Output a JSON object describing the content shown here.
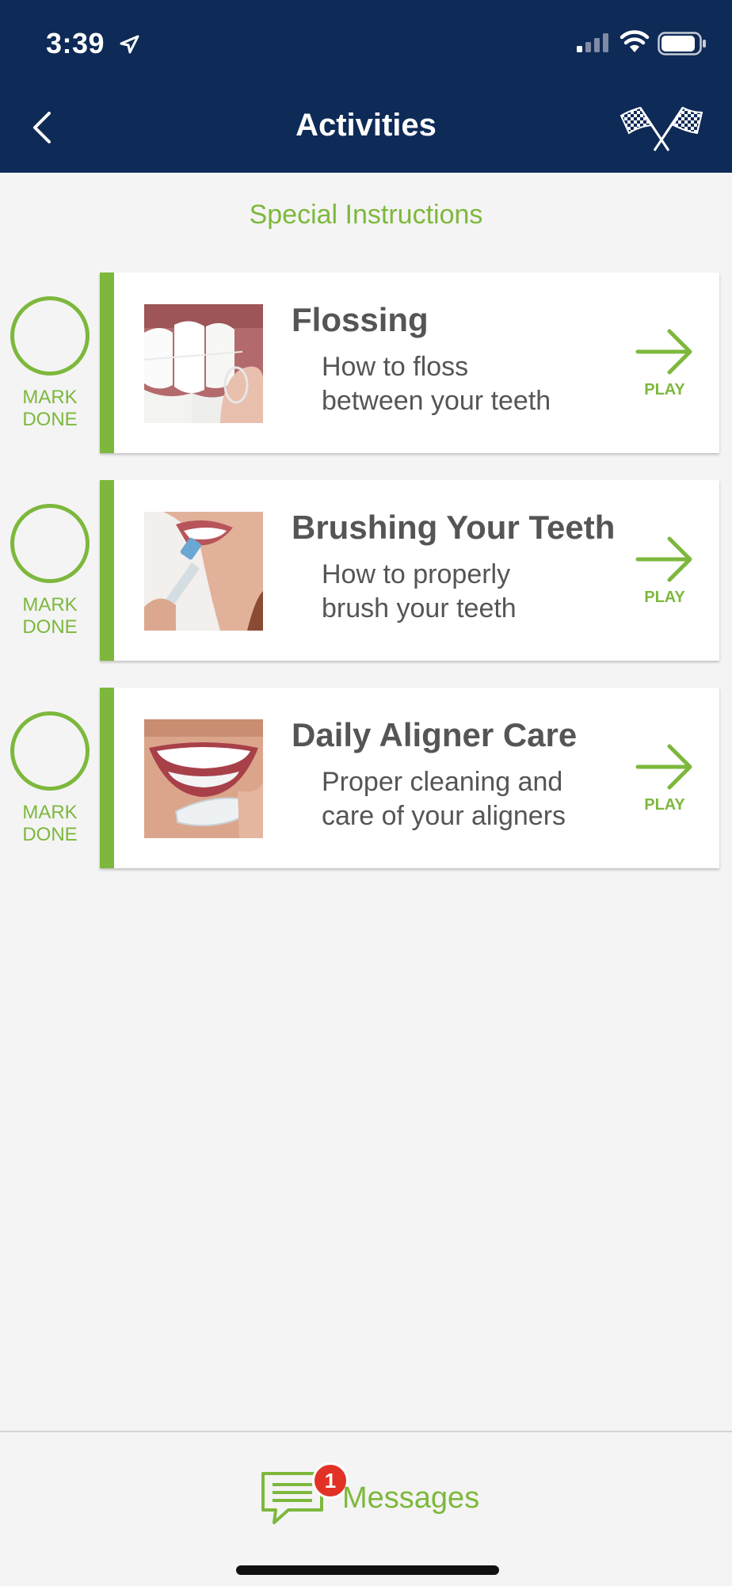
{
  "status_bar": {
    "time": "3:39"
  },
  "header": {
    "title": "Activities"
  },
  "section": {
    "title": "Special Instructions"
  },
  "activities": [
    {
      "mark_label_1": "MARK",
      "mark_label_2": "DONE",
      "title": "Flossing",
      "desc_1": "How to floss",
      "desc_2": "between your teeth",
      "play_label": "PLAY"
    },
    {
      "mark_label_1": "MARK",
      "mark_label_2": "DONE",
      "title": "Brushing Your Teeth",
      "desc_1": "How to properly",
      "desc_2": "brush your teeth",
      "play_label": "PLAY"
    },
    {
      "mark_label_1": "MARK",
      "mark_label_2": "DONE",
      "title": "Daily Aligner Care",
      "desc_1": "Proper cleaning and",
      "desc_2": "care of your aligners",
      "play_label": "PLAY"
    }
  ],
  "bottom_bar": {
    "messages_label": "Messages",
    "badge_count": "1"
  },
  "colors": {
    "header_bg": "#0e2a57",
    "accent_green": "#7db83c",
    "badge_red": "#e23226",
    "text_gray": "#555555"
  },
  "icons": {
    "back": "chevron-left-icon",
    "flags": "checkered-flags-icon",
    "play": "arrow-right-icon",
    "messages": "chat-bubble-icon"
  }
}
